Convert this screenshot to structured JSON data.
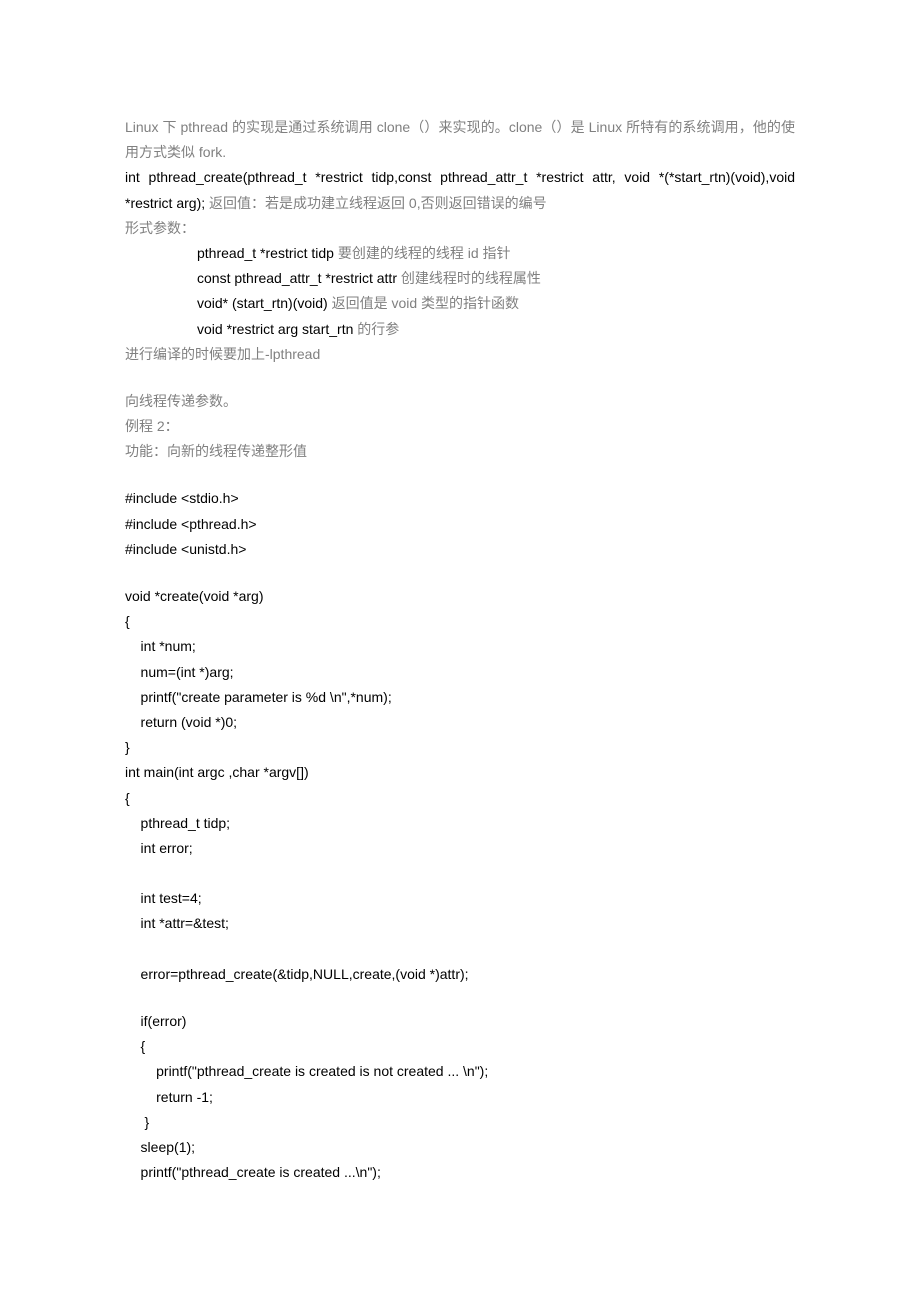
{
  "para1": "Linux 下 pthread 的实现是通过系统调用 clone（）来实现的。clone（）是 Linux 所特有的系统调用，他的使用方式类似 fork.",
  "sig_part1": "int  pthread_create(pthread_t  *restrict  tidp,const  pthread_attr_t  *restrict  attr,  void *(*start_rtn)(void),void *restrict arg);",
  "sig_part2": "  返回值：若是成功建立线程返回 0,否则返回错误的编号",
  "formparam_label": "形式参数：",
  "param1_code": "pthread_t *restrict tidp",
  "param1_desc": "  要创建的线程的线程 id 指针",
  "param2_code": "const pthread_attr_t *restrict attr",
  "param2_desc": "  创建线程时的线程属性",
  "param3_code": "void* (start_rtn)(void)",
  "param3_desc": "  返回值是 void 类型的指针函数",
  "param4_code": "void *restrict arg   start_rtn",
  "param4_desc": " 的行参",
  "compile_note": "进行编译的时候要加上-lpthread",
  "pass_param_note": "向线程传递参数。",
  "example_label": "例程 2：",
  "example_desc": " 功能：向新的线程传递整形值",
  "code": {
    "l1": "#include <stdio.h>",
    "l2": "#include <pthread.h>",
    "l3": "#include <unistd.h>",
    "l4": "",
    "l5": "void *create(void *arg)",
    "l6": "{",
    "l7": "    int *num;",
    "l8": "    num=(int *)arg;",
    "l9": "    printf(\"create parameter is %d \\n\",*num);",
    "l10": "    return (void *)0;",
    "l11": "}",
    "l12": "int main(int argc ,char *argv[])",
    "l13": "{",
    "l14": "    pthread_t tidp;",
    "l15": "    int error;",
    "l16": "    ",
    "l17": "    int test=4;",
    "l18": "    int *attr=&test;",
    "l19": "    ",
    "l20": "    error=pthread_create(&tidp,NULL,create,(void *)attr);",
    "l21": "",
    "l22": "    if(error)",
    "l23": "    {",
    "l24": "        printf(\"pthread_create is created is not created ... \\n\");",
    "l25": "        return -1;",
    "l26": "     }",
    "l27": "    sleep(1);",
    "l28": "    printf(\"pthread_create is created ...\\n\");"
  }
}
